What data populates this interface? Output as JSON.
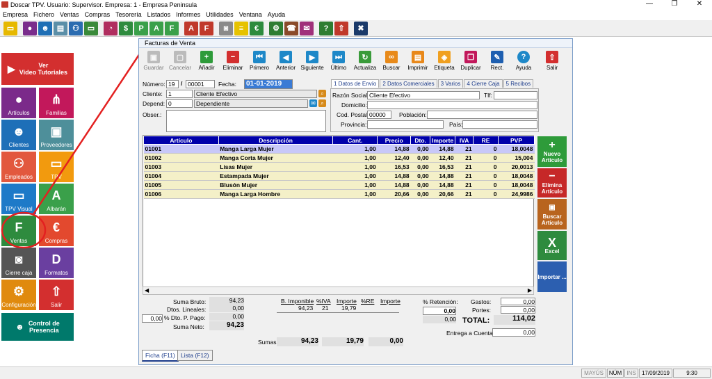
{
  "window": {
    "title": "Doscar TPV. Usuario: Supervisor. Empresa: 1 - Empresa Peninsula"
  },
  "menu": [
    "Empresa",
    "Fichero",
    "Ventas",
    "Compras",
    "Tesorería",
    "Listados",
    "Informes",
    "Utilidades",
    "Ventana",
    "Ayuda"
  ],
  "sidebar": {
    "video": "Ver\nVideo Tutoriales",
    "tiles": [
      "Artículos",
      "Familias",
      "Clientes",
      "Proveedores",
      "Empleados",
      "TPV",
      "TPV Visual",
      "Albarán",
      "Ventas",
      "Compras",
      "Cierre caja",
      "Formatos",
      "Configuración",
      "Salir"
    ],
    "presencia": "Control de\nPresencia"
  },
  "panel": {
    "title": "Facturas de Venta",
    "toolbar": [
      "Guardar",
      "Cancelar",
      "Añadir",
      "Eliminar",
      "Primero",
      "Anterior",
      "Siguiente",
      "Último",
      "Actualiza",
      "Buscar",
      "Imprimir",
      "Etiqueta",
      "Duplicar",
      "Rect.",
      "Ayuda",
      "Salir"
    ]
  },
  "form": {
    "numero_label": "Número:",
    "numero_serie": "19",
    "numero_sep": "/",
    "numero": "00001",
    "fecha_label": "Fecha:",
    "fecha": "01-01-2019",
    "cliente_label": "Cliente:",
    "cliente_code": "1",
    "cliente_name": "Cliente Efectivo",
    "depend_label": "Depend:",
    "depend_code": "0",
    "depend_name": "Dependiente",
    "obser_label": "Obser.:"
  },
  "tabs": [
    "1 Datos de Envío",
    "2 Datos Comerciales",
    "3 Varios",
    "4 Cierre Caja",
    "5 Recibos"
  ],
  "envio": {
    "razon_label": "Razón Social:",
    "razon": "Cliente Efectivo",
    "tlf_label": "Tlf:",
    "domicilio_label": "Domicilio:",
    "cp_label": "Cod. Postal:",
    "cp": "00000",
    "poblacion_label": "Población:",
    "provincia_label": "Provincia:",
    "pais_label": "País:"
  },
  "grid": {
    "headers": [
      "Artículo",
      "Descripción",
      "Cant.",
      "Precio",
      "Dto.",
      "Importe",
      "IVA",
      "RE",
      "PVP"
    ],
    "rows": [
      [
        "01001",
        "Manga Larga Mujer",
        "1,00",
        "14,88",
        "0,00",
        "14,88",
        "21",
        "0",
        "18,0048"
      ],
      [
        "01002",
        "Manga Corta Mujer",
        "1,00",
        "12,40",
        "0,00",
        "12,40",
        "21",
        "0",
        "15,004"
      ],
      [
        "01003",
        "Lisas Mujer",
        "1,00",
        "16,53",
        "0,00",
        "16,53",
        "21",
        "0",
        "20,0013"
      ],
      [
        "01004",
        "Estampada Mujer",
        "1,00",
        "14,88",
        "0,00",
        "14,88",
        "21",
        "0",
        "18,0048"
      ],
      [
        "01005",
        "Blusón Mujer",
        "1,00",
        "14,88",
        "0,00",
        "14,88",
        "21",
        "0",
        "18,0048"
      ],
      [
        "01006",
        "Manga Larga Hombre",
        "1,00",
        "20,66",
        "0,00",
        "20,66",
        "21",
        "0",
        "24,9986"
      ]
    ]
  },
  "right_buttons": [
    "Nuevo Artículo",
    "Elimina Artículo",
    "Buscar Artículo",
    "Excel",
    "Importar ..."
  ],
  "totals": {
    "suma_bruto_label": "Suma Bruto:",
    "suma_bruto": "94,23",
    "dtos_label": "Dtos. Lineales:",
    "dtos": "0,00",
    "dto_pp_pct": "0,00",
    "dto_pp_label": "% Dto. P. Pago:",
    "dto_pp": "0,00",
    "suma_neto_label": "Suma Neto:",
    "suma_neto": "94,23",
    "bi_headers": [
      "B. Imponible",
      "%IVA",
      "Importe",
      "%RE",
      "Importe"
    ],
    "bi_row": [
      "94,23",
      "21",
      "19,79",
      "",
      ""
    ],
    "retencion_label": "% Retención:",
    "retencion_pct": "",
    "retencion_val": "0,00",
    "retencion_imp": "0,00",
    "gastos_label": "Gastos:",
    "gastos": "0,00",
    "portes_label": "Portes:",
    "portes": "0,00",
    "total_label": "TOTAL:",
    "total": "114,02",
    "entrega_label": "Entrega a Cuenta:",
    "entrega": "0,00",
    "sumas_label": "Sumas:",
    "sumas": [
      "94,23",
      "19,79",
      "0,00"
    ]
  },
  "bottom_tabs": [
    "Ficha (F11)",
    "Lista (F12)"
  ],
  "status": {
    "mayus": "MAYÚS",
    "num": "NÚM",
    "ins": "INS",
    "date": "17/09/2019",
    "time": "9:30"
  }
}
